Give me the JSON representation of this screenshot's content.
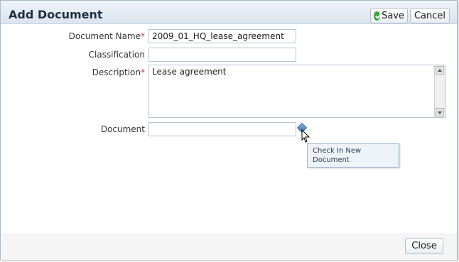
{
  "dialog": {
    "title": "Add Document",
    "save_label": "Save",
    "cancel_label": "Cancel",
    "close_label": "Close"
  },
  "form": {
    "document_name": {
      "label": "Document Name",
      "required_mark": "*",
      "value": "2009_01_HQ_lease_agreement"
    },
    "classification": {
      "label": "Classification",
      "value": ""
    },
    "description": {
      "label": "Description",
      "required_mark": "*",
      "value": "Lease agreement"
    },
    "document": {
      "label": "Document",
      "value": ""
    }
  },
  "tooltip": {
    "text": "Check In New Document"
  },
  "colors": {
    "save_check": "#3aa33a",
    "required": "#c0392b",
    "titlebar": "#dbe5ef"
  },
  "icons": {
    "save": "check-circle-icon",
    "check_in": "diamond-icon",
    "cursor": "hand-pointer-icon"
  }
}
